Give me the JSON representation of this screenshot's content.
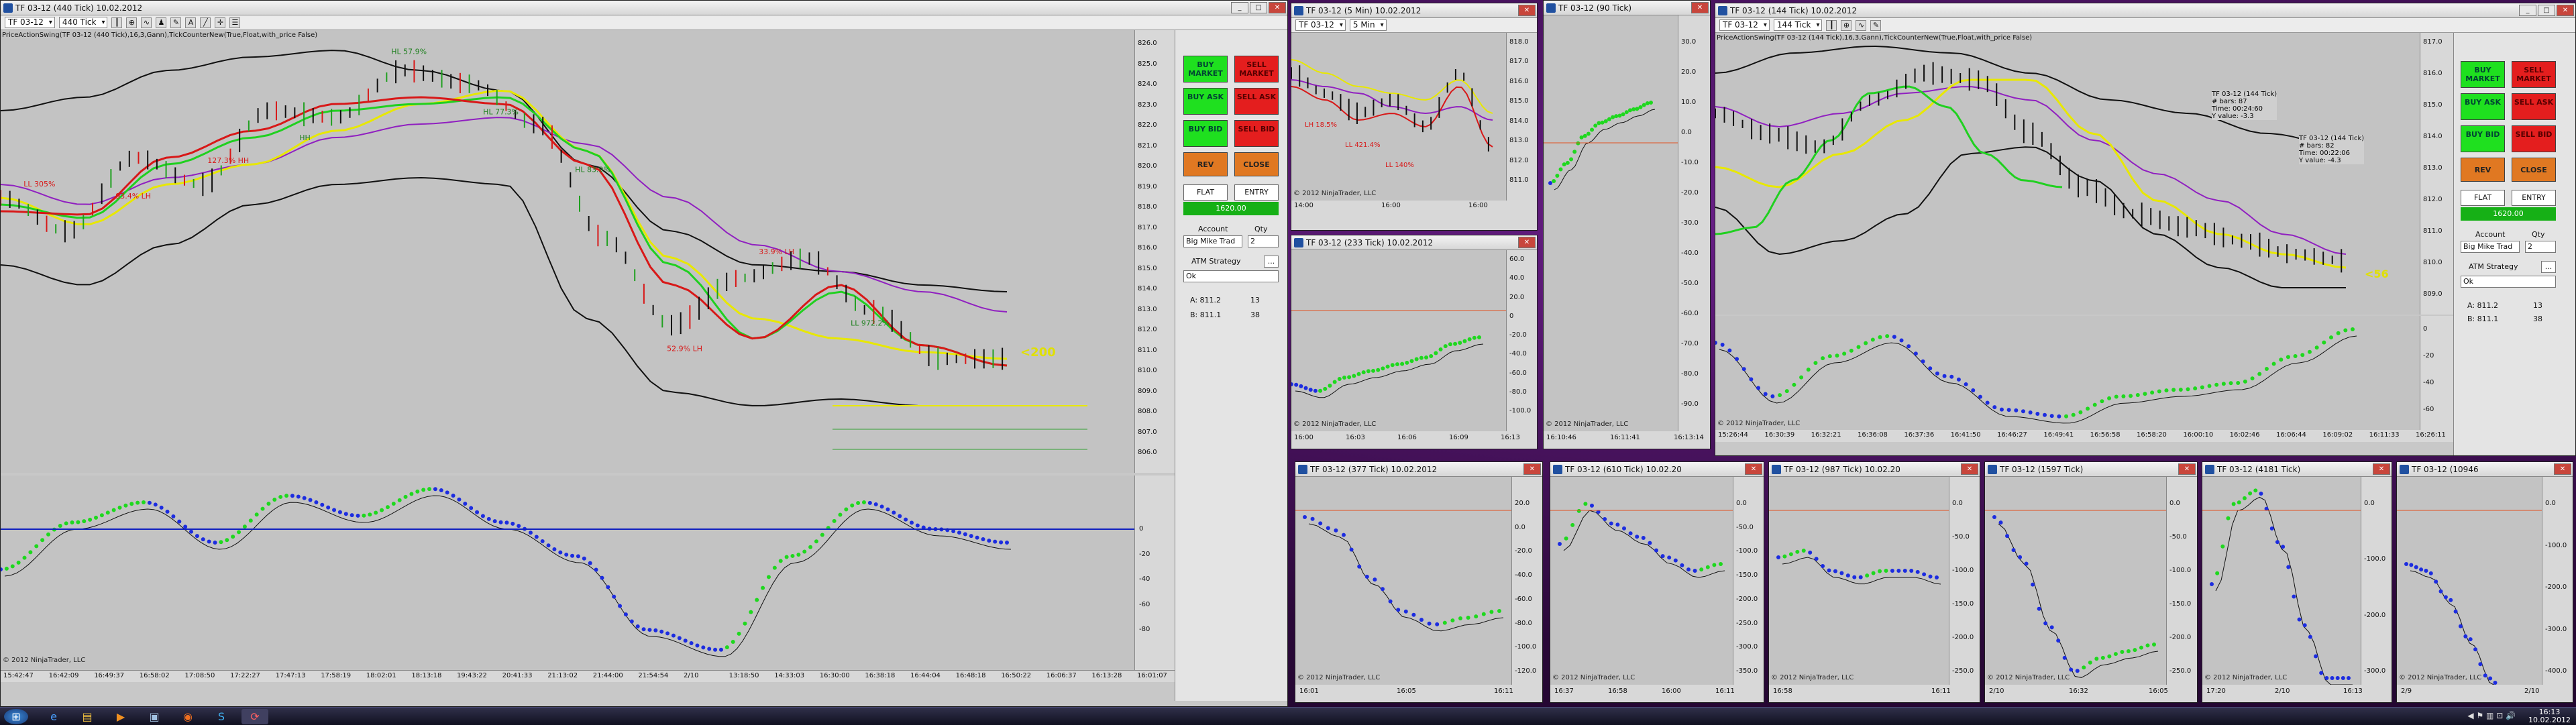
{
  "main": {
    "title": "TF 03-12 (440 Tick)  10.02.2012",
    "toolbar": {
      "instrument": "TF 03-12",
      "period": "440 Tick"
    },
    "indicator_title": "PriceActionSwing(TF 03-12 (440 Tick),16,3,Gann),TickCounterNew(True,Float,with_price False)",
    "swing_labels": [
      "LL 305%",
      "93.4% LH",
      "127.3% HH",
      "HH",
      "HL 57.9%",
      "HL 77.3%",
      "HL 83.9%",
      "52.9% LH",
      "33.9% LH",
      "LL 972.2%"
    ],
    "tick_counter": "<200",
    "price_axis": [
      "826.0",
      "825.0",
      "824.0",
      "823.0",
      "822.0",
      "821.0",
      "820.0",
      "819.0",
      "818.0",
      "817.0",
      "816.0",
      "815.0",
      "814.0",
      "813.0",
      "812.0",
      "811.0",
      "810.0",
      "809.0",
      "808.0",
      "807.0",
      "806.0"
    ],
    "price_tags": [
      {
        "label": "811.3",
        "color": "#101010"
      },
      {
        "label": "811.2",
        "color": "#e0e000"
      },
      {
        "label": "811.1",
        "color": "#e0a000"
      }
    ],
    "osc_axis": [
      "0",
      "-20",
      "-40",
      "-60",
      "-80"
    ],
    "time_axis": [
      "15:42:47",
      "16:42:09",
      "16:49:37",
      "16:58:02",
      "17:08:50",
      "17:22:27",
      "17:47:13",
      "17:58:19",
      "18:02:01",
      "18:13:18",
      "19:43:22",
      "20:41:33",
      "21:13:02",
      "21:44:00",
      "21:54:54",
      "2/10",
      "13:18:50",
      "14:33:03",
      "16:30:00",
      "16:38:18",
      "16:44:04",
      "16:48:18",
      "16:50:22",
      "16:06:37",
      "16:13:28",
      "16:01:07"
    ],
    "copyright": "© 2012 NinjaTrader, LLC"
  },
  "panel_main": {
    "buy_market": "BUY MARKET",
    "sell_market": "SELL MARKET",
    "buy_ask": "BUY ASK",
    "sell_ask": "SELL ASK",
    "buy_bid": "BUY BID",
    "sell_bid": "SELL BID",
    "rev": "REV",
    "close": "CLOSE",
    "flat": "FLAT",
    "entry": "ENTRY",
    "price": "1620.00",
    "account_label": "Account",
    "qty_label": "Qty",
    "account": "Big Mike Trad",
    "qty": "2",
    "atm_label": "ATM Strategy",
    "atm_value": "Ok",
    "ask": "A: 811.2",
    "ask_size": "13",
    "bid": "B: 811.1",
    "bid_size": "38"
  },
  "win_5min": {
    "title": "TF 03-12 (5 Min)  10.02.2012",
    "toolbar": {
      "instrument": "TF 03-12",
      "period": "5 Min"
    },
    "labels": [
      "LH 18.5%",
      "LL 421.4%",
      "LL 140%"
    ],
    "time_axis": [
      "14:00",
      "16:00",
      "16:00"
    ],
    "price_axis": [
      "818.0",
      "817.0",
      "816.0",
      "815.0",
      "814.0",
      "813.0",
      "812.0",
      "811.0"
    ],
    "copyright": "© 2012 NinjaTrader, LLC"
  },
  "win_90": {
    "title": "TF 03-12 (90 Tick)",
    "price_axis": [
      "30.0",
      "20.0",
      "10.0",
      "0.0",
      "-10.0",
      "-20.0",
      "-30.0",
      "-40.0",
      "-50.0",
      "-60.0",
      "-70.0",
      "-80.0",
      "-90.0"
    ],
    "time_axis": [
      "16:10:46",
      "16:11:41",
      "16:13:14"
    ],
    "copyright": "© 2012 NinjaTrader, LLC"
  },
  "win_233": {
    "title": "TF 03-12 (233 Tick)  10.02.2012",
    "price_axis": [
      "60.0",
      "40.0",
      "20.0",
      "0",
      "-20.0",
      "-40.0",
      "-60.0",
      "-80.0",
      "-100.0"
    ],
    "time_axis": [
      "16:00",
      "16:03",
      "16:06",
      "16:09",
      "16:13"
    ],
    "copyright": "© 2012 NinjaTrader, LLC"
  },
  "win_144": {
    "title": "TF 03-12 (144 Tick)  10.02.2012",
    "toolbar": {
      "instrument": "TF 03-12",
      "period": "144 Tick"
    },
    "indicator_title": "PriceActionSwing(TF 03-12 (144 Tick),16,3,Gann),TickCounterNew(True,Float,with_price False)",
    "tick_counter": "<56",
    "info1": [
      "TF 03-12 (144 Tick)",
      "# bars: 87",
      "Time: 00:24:60",
      "Y value: -3.3"
    ],
    "info2": [
      "TF 03-12 (144 Tick)",
      "# bars: 82",
      "Time: 00:22:06",
      "Y value: -4.3"
    ],
    "price_axis": [
      "817.0",
      "816.0",
      "815.0",
      "814.0",
      "813.0",
      "812.0",
      "811.0",
      "810.0",
      "809.0"
    ],
    "osc_axis": [
      "0",
      "-20",
      "-40",
      "-60"
    ],
    "time_axis": [
      "15:26:44",
      "16:30:39",
      "16:32:21",
      "16:36:08",
      "16:37:36",
      "16:41:50",
      "16:46:27",
      "16:49:41",
      "16:56:58",
      "16:58:20",
      "16:00:10",
      "16:02:46",
      "16:06:44",
      "16:09:02",
      "16:11:33",
      "16:26:11"
    ],
    "copyright": "© 2012 NinjaTrader, LLC"
  },
  "panel_144": {
    "buy_market": "BUY MARKET",
    "sell_market": "SELL MARKET",
    "buy_ask": "BUY ASK",
    "sell_ask": "SELL ASK",
    "buy_bid": "BUY BID",
    "sell_bid": "SELL BID",
    "rev": "REV",
    "close": "CLOSE",
    "flat": "FLAT",
    "entry": "ENTRY",
    "price": "1620.00",
    "account_label": "Account",
    "qty_label": "Qty",
    "account": "Big Mike Trad",
    "qty": "2",
    "atm_label": "ATM Strategy",
    "atm_value": "Ok",
    "ask": "A: 811.2",
    "ask_size": "13",
    "bid": "B: 811.1",
    "bid_size": "38"
  },
  "small_windows": [
    {
      "title": "TF 03-12 (377 Tick)  10.02.2012",
      "axis": [
        "20.0",
        "0.0",
        "-20.0",
        "-40.0",
        "-60.0",
        "-80.0",
        "-100.0",
        "-120.0"
      ],
      "time": [
        "16:01",
        "16:05",
        "16:11"
      ]
    },
    {
      "title": "TF 03-12 (610 Tick)  10.02.20",
      "axis": [
        "0.0",
        "-50.0",
        "-100.0",
        "-150.0",
        "-200.0",
        "-250.0",
        "-300.0",
        "-350.0"
      ],
      "time": [
        "16:37",
        "16:58",
        "16:00",
        "16:11"
      ]
    },
    {
      "title": "TF 03-12 (987 Tick)  10.02.20",
      "axis": [
        "0.0",
        "-50.0",
        "-100.0",
        "-150.0",
        "-200.0",
        "-250.0"
      ],
      "time": [
        "16:58",
        "16:11"
      ]
    },
    {
      "title": "TF 03-12 (1597 Tick)",
      "axis": [
        "0.0",
        "-50.0",
        "-100.0",
        "-150.0",
        "-200.0",
        "-250.0"
      ],
      "time": [
        "2/10",
        "16:32",
        "16:05"
      ]
    },
    {
      "title": "TF 03-12 (4181 Tick)",
      "axis": [
        "0.0",
        "-100.0",
        "-200.0",
        "-300.0"
      ],
      "time": [
        "17:20",
        "2/10",
        "16:13"
      ]
    },
    {
      "title": "TF 03-12 (10946",
      "axis": [
        "0.0",
        "-100.0",
        "-200.0",
        "-300.0",
        "-400.0"
      ],
      "time": [
        "2/9",
        "2/10"
      ]
    }
  ],
  "small_copyright": "© 2012 NinjaTrader, LLC",
  "taskbar": {
    "time": "16:13",
    "date": "10.02.2012"
  },
  "colors": {
    "green_btn": "#1fe01f",
    "red_btn": "#e41e1e",
    "orange_btn": "#e07822",
    "chart_bg": "#c3c3c3",
    "osc_blue": "#1c2ce0",
    "osc_green": "#1ed81e"
  }
}
